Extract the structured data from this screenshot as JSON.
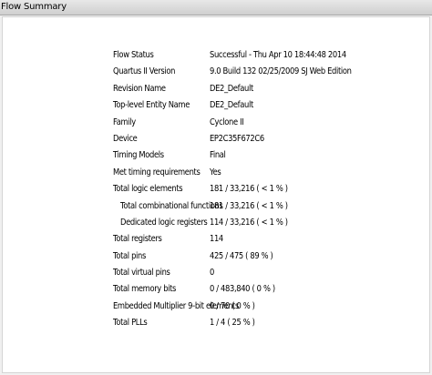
{
  "window": {
    "title": "Flow Summary"
  },
  "summary": {
    "rows": [
      {
        "label": "Flow Status",
        "value": "Successful - Thu Apr 10 18:44:48 2014"
      },
      {
        "label": "Quartus II Version",
        "value": "9.0 Build 132 02/25/2009 SJ Web Edition"
      },
      {
        "label": "Revision Name",
        "value": "DE2_Default"
      },
      {
        "label": "Top-level Entity Name",
        "value": "DE2_Default"
      },
      {
        "label": "Family",
        "value": "Cyclone II"
      },
      {
        "label": "Device",
        "value": "EP2C35F672C6"
      },
      {
        "label": "Timing Models",
        "value": "Final"
      },
      {
        "label": "Met timing requirements",
        "value": "Yes"
      },
      {
        "label": "Total logic elements",
        "value": "181 / 33,216 ( < 1 % )"
      },
      {
        "label": "Total combinational functions",
        "value": "181 / 33,216 ( < 1 % )"
      },
      {
        "label": "Dedicated logic registers",
        "value": "114 / 33,216 ( < 1 % )"
      },
      {
        "label": "Total registers",
        "value": "114"
      },
      {
        "label": "Total pins",
        "value": "425 / 475 ( 89 % )"
      },
      {
        "label": "Total virtual pins",
        "value": "0"
      },
      {
        "label": "Total memory bits",
        "value": "0 / 483,840 ( 0 % )"
      },
      {
        "label": "Embedded Multiplier 9-bit elements",
        "value": "0 / 70 ( 0 % )"
      },
      {
        "label": "Total PLLs",
        "value": "1 / 4 ( 25 % )"
      }
    ]
  }
}
